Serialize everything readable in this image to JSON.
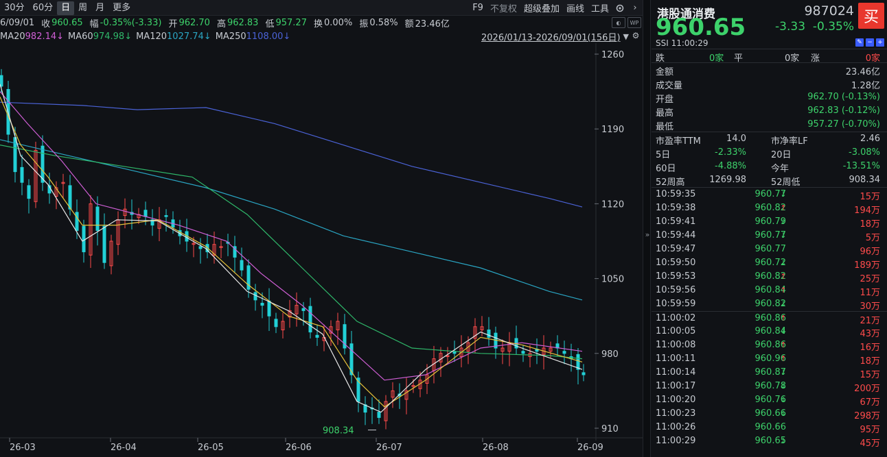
{
  "toolbar": {
    "left_tabs": [
      "30分",
      "60分",
      "日",
      "周",
      "月",
      "更多"
    ],
    "active_tab": "日",
    "right_tabs": [
      "F9",
      "不复权",
      "超级叠加",
      "画线",
      "工具"
    ]
  },
  "info": {
    "date": "6/09/01",
    "close_label": "收",
    "close_value": "960.65",
    "amp_label": "幅",
    "amp_value": "-0.35%(-3.33)",
    "open_label": "开",
    "open_value": "962.70",
    "high_label": "高",
    "high_value": "962.83",
    "low_label": "低",
    "low_value": "957.27",
    "turnover_label": "换",
    "turnover_value": "0.00%",
    "swing_label": "振",
    "swing_value": "0.58%",
    "amount_label": "额",
    "amount_value": "23.46亿"
  },
  "ma": {
    "ma20_label": "MA20",
    "ma20_value": "982.14↓",
    "ma60_label": "MA60",
    "ma60_value": "974.98↓",
    "ma120_label": "MA120",
    "ma120_value": "1027.74↓",
    "ma250_label": "MA250",
    "ma250_value": "1108.00↓",
    "range": "2026/01/13-2026/09/01(156日)"
  },
  "colors": {
    "up": "#ff4b4b",
    "down": "#3dd26b",
    "candle": "#22d0d6",
    "ma5": "#e8e8e8",
    "ma10": "#e7c33b",
    "ma20": "#d05fd6",
    "ma60": "#2fb86a",
    "ma120": "#2aa6c4",
    "ma250": "#4b63d8"
  },
  "chart_data": {
    "type": "candlestick",
    "y_axis_ticks": [
      910,
      980,
      1050,
      1120,
      1190,
      1260
    ],
    "x_axis_ticks": [
      "26-03",
      "26-04",
      "26-05",
      "26-06",
      "26-07",
      "26-08",
      "26-09"
    ],
    "min_annotation": "908.34",
    "ylim": [
      905,
      1268
    ]
  },
  "panel": {
    "name": "港股通消费",
    "code": "987024",
    "buy_label": "买",
    "price": "960.65",
    "change": "-3.33",
    "change_pct": "-0.35%",
    "ssi_label": "SSI",
    "time": "11:00:29",
    "adv": {
      "fall_label": "跌",
      "fall": "0家",
      "flat_label": "平",
      "flat": "0家",
      "rise_label": "涨",
      "rise": "0家"
    },
    "stats": [
      {
        "label": "金额",
        "value": "23.46亿"
      },
      {
        "label": "成交量",
        "value": "1.28亿"
      },
      {
        "label": "开盘",
        "value": "962.70 (-0.13%)"
      },
      {
        "label": "最高",
        "value": "962.83 (-0.12%)"
      },
      {
        "label": "最低",
        "value": "957.27 (-0.70%)"
      }
    ],
    "pe_label": "市盈率TTM",
    "pe": "14.0",
    "pb_label": "市净率LF",
    "pb": "2.46",
    "d5_label": "5日",
    "d5": "-2.33%",
    "d20_label": "20日",
    "d20": "-3.08%",
    "d60_label": "60日",
    "d60": "-4.88%",
    "ytd_label": "今年",
    "ytd": "-13.51%",
    "w52h_label": "52周高",
    "w52h": "1269.98",
    "w52l_label": "52周低",
    "w52l": "908.34",
    "ticks": [
      {
        "time": "10:59:35",
        "price": "960.77",
        "dir": "down",
        "vol": "15万"
      },
      {
        "time": "10:59:38",
        "price": "960.82",
        "dir": "up",
        "vol": "194万"
      },
      {
        "time": "10:59:41",
        "price": "960.79",
        "dir": "down",
        "vol": "18万"
      },
      {
        "time": "10:59:44",
        "price": "960.77",
        "dir": "down",
        "vol": "5万"
      },
      {
        "time": "10:59:47",
        "price": "960.77",
        "dir": "none",
        "vol": "96万"
      },
      {
        "time": "10:59:50",
        "price": "960.72",
        "dir": "down",
        "vol": "189万"
      },
      {
        "time": "10:59:53",
        "price": "960.82",
        "dir": "up",
        "vol": "25万"
      },
      {
        "time": "10:59:56",
        "price": "960.84",
        "dir": "up",
        "vol": "11万"
      },
      {
        "time": "10:59:59",
        "price": "960.82",
        "dir": "down",
        "vol": "30万"
      },
      {
        "time": "11:00:02",
        "price": "960.86",
        "dir": "up",
        "vol": "21万"
      },
      {
        "time": "11:00:05",
        "price": "960.84",
        "dir": "down",
        "vol": "43万"
      },
      {
        "time": "11:00:08",
        "price": "960.86",
        "dir": "up",
        "vol": "16万"
      },
      {
        "time": "11:00:11",
        "price": "960.96",
        "dir": "up",
        "vol": "18万"
      },
      {
        "time": "11:00:14",
        "price": "960.87",
        "dir": "down",
        "vol": "15万"
      },
      {
        "time": "11:00:17",
        "price": "960.78",
        "dir": "down",
        "vol": "200万"
      },
      {
        "time": "11:00:20",
        "price": "960.76",
        "dir": "down",
        "vol": "67万"
      },
      {
        "time": "11:00:23",
        "price": "960.66",
        "dir": "down",
        "vol": "298万"
      },
      {
        "time": "11:00:26",
        "price": "960.66",
        "dir": "none",
        "vol": "95万"
      },
      {
        "time": "11:00:29",
        "price": "960.65",
        "dir": "down",
        "vol": "45万"
      }
    ]
  }
}
